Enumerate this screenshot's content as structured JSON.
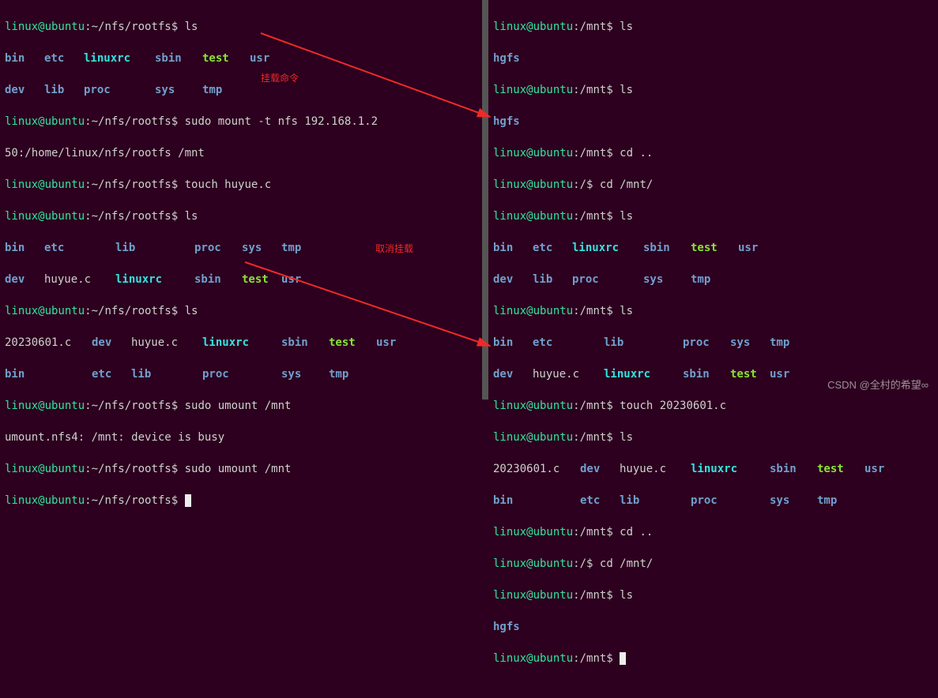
{
  "left": {
    "prompt_user": "linux@ubuntu",
    "path1": "~/nfs/rootfs",
    "cmd_ls": "ls",
    "ls1": [
      "bin",
      "etc",
      "linuxrc",
      "sbin",
      "test",
      "usr"
    ],
    "ls1b": [
      "dev",
      "lib",
      "proc",
      "sys",
      "tmp"
    ],
    "cmd_mount": "sudo mount -t nfs 192.168.1.2",
    "cmd_mount2": "50:/home/linux/nfs/rootfs /mnt",
    "anno_mount": "挂载命令",
    "cmd_touch": "touch huyue.c",
    "ls2a": [
      "bin",
      "etc",
      "lib",
      "proc",
      "sys",
      "tmp"
    ],
    "ls2b": [
      "dev",
      "huyue.c",
      "linuxrc",
      "sbin",
      "test",
      "usr"
    ],
    "ls3a": [
      "20230601.c",
      "dev",
      "huyue.c",
      "linuxrc",
      "sbin",
      "test",
      "usr"
    ],
    "ls3b": [
      "bin",
      "etc",
      "lib",
      "proc",
      "sys",
      "tmp"
    ],
    "cmd_umount": "sudo umount /mnt",
    "msg_busy": "umount.nfs4: /mnt: device is busy",
    "anno_umount": "取消挂载"
  },
  "right": {
    "prompt_user": "linux@ubuntu",
    "path_mnt": "/mnt",
    "path_root": "/",
    "cmd_ls": "ls",
    "cmd_cdup": "cd ..",
    "cmd_cdmnt": "cd /mnt/",
    "cmd_touch": "touch 20230601.c",
    "hgfs": "hgfs",
    "lsA": [
      "bin",
      "etc",
      "linuxrc",
      "sbin",
      "test",
      "usr"
    ],
    "lsAb": [
      "dev",
      "lib",
      "proc",
      "sys",
      "tmp"
    ],
    "lsB": [
      "bin",
      "etc",
      "lib",
      "proc",
      "sys",
      "tmp"
    ],
    "lsBb": [
      "dev",
      "huyue.c",
      "linuxrc",
      "sbin",
      "test",
      "usr"
    ],
    "lsC": [
      "20230601.c",
      "dev",
      "huyue.c",
      "linuxrc",
      "sbin",
      "test",
      "usr"
    ],
    "lsCb": [
      "bin",
      "etc",
      "lib",
      "proc",
      "sys",
      "tmp"
    ]
  },
  "watermark": "CSDN @全村的希望∞"
}
